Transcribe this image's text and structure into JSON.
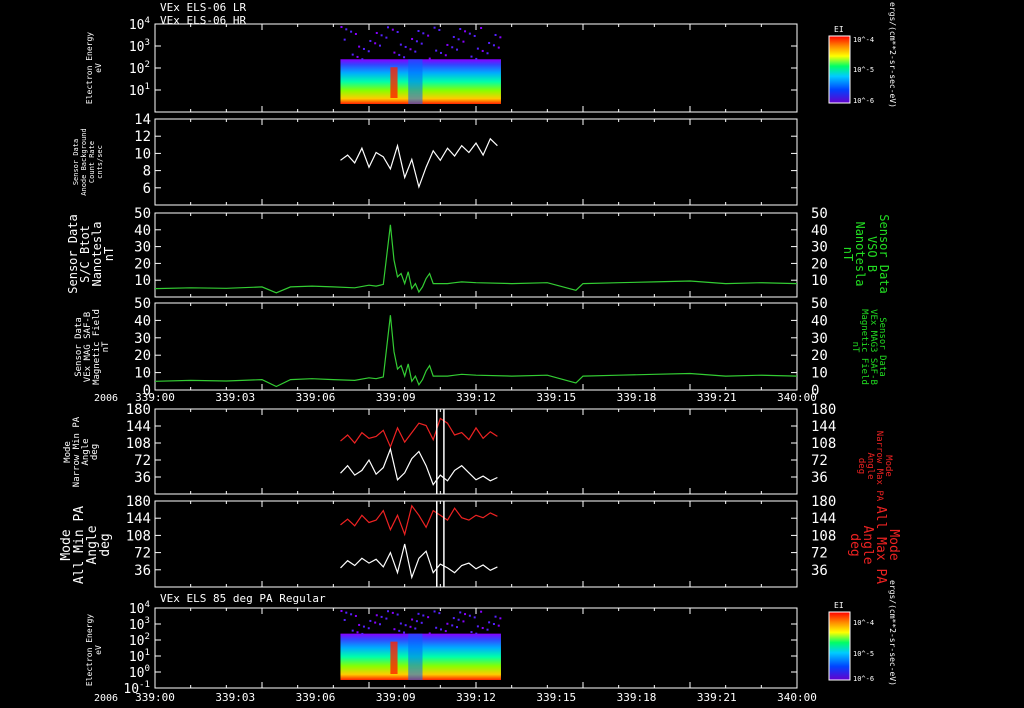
{
  "header": {
    "line1": "VEx ELS-06 LR",
    "line2": "VEx ELS-06 HR"
  },
  "year_label": "2006",
  "x_axis": {
    "ticks": [
      "339:00",
      "339:03",
      "339:06",
      "339:09",
      "339:12",
      "339:15",
      "339:18",
      "339:21",
      "340:00"
    ],
    "range_minutes": [
      0,
      180
    ]
  },
  "colors": {
    "background": "#000000",
    "axis": "#ffffff",
    "magnetometer": "#33cc33",
    "max_pa": "#ee2222",
    "min_pa": "#ffffff",
    "label_green": "#22dd22",
    "label_red": "#ee2222"
  },
  "chart_data": [
    {
      "type": "heatmap",
      "id": "spectrogram_top",
      "ylabel": [
        "Electron Energy",
        "eV"
      ],
      "yscale": "log",
      "ylim": [
        1,
        10000
      ],
      "yticks": [
        "10^4",
        "10^3",
        "10^2",
        "10^1"
      ],
      "data_xrange_minutes": [
        52,
        97
      ],
      "colorbar": {
        "title": "EI",
        "ticks": [
          "10^-4",
          "10^-5",
          "10^-6"
        ]
      },
      "units_right": "ergs/(cm**2-sr-sec-eV)"
    },
    {
      "type": "line",
      "id": "count_rate",
      "ylabel": [
        "Sensor Data",
        "Anode Background",
        "Count Rate",
        "cnts/sec"
      ],
      "ylim": [
        4,
        14
      ],
      "yticks": [
        6,
        8,
        10,
        12,
        14
      ],
      "series": [
        {
          "color": "white",
          "x": [
            52,
            54,
            56,
            58,
            60,
            62,
            64,
            66,
            68,
            70,
            72,
            74,
            76,
            78,
            80,
            82,
            84,
            86,
            88,
            90,
            92,
            94,
            96
          ],
          "y": [
            9.2,
            9.8,
            8.9,
            10.6,
            8.4,
            10.1,
            9.6,
            8.2,
            10.9,
            7.2,
            9.3,
            6.1,
            8.4,
            10.3,
            9.2,
            10.6,
            9.7,
            10.9,
            10.1,
            11.2,
            9.8,
            11.7,
            10.9
          ]
        }
      ]
    },
    {
      "type": "line",
      "id": "bmag_sc",
      "ylabel": [
        "Sensor Data",
        "S/C Btot",
        "Nanotesla",
        "nT"
      ],
      "ylabel_right": [
        "Sensor Data",
        "VSO B",
        "Nanotesla",
        "nT"
      ],
      "ylim": [
        0,
        50
      ],
      "yticks": [
        10,
        20,
        30,
        40,
        50
      ],
      "series": [
        {
          "color": "green",
          "x": [
            0,
            10,
            20,
            30,
            34,
            38,
            44,
            50,
            56,
            60,
            62,
            64,
            66,
            67,
            68,
            69,
            70,
            71,
            72,
            73,
            74,
            75,
            76,
            77,
            78,
            80,
            82,
            84,
            86,
            90,
            100,
            110,
            118,
            120,
            130,
            140,
            150,
            160,
            170,
            180
          ],
          "y": [
            5,
            5.5,
            5.2,
            6,
            2.5,
            6,
            6.5,
            6,
            5.5,
            7,
            6.5,
            7.5,
            43,
            22,
            12,
            14,
            8,
            15,
            5,
            8,
            3,
            6,
            11,
            14,
            8,
            8,
            8,
            8.5,
            9,
            8.5,
            8,
            8.5,
            4,
            8,
            8.5,
            9,
            9.5,
            8,
            8.5,
            8
          ]
        }
      ]
    },
    {
      "type": "line",
      "id": "bmag_saf",
      "ylabel": [
        "Sensor Data",
        "VEx MAG SAF-B",
        "Magnetic Field",
        "nT"
      ],
      "ylabel_right": [
        "Sensor Data",
        "VEx MAG3 SAF-B",
        "Magnetic Field",
        "nT"
      ],
      "ylim": [
        0,
        50
      ],
      "yticks": [
        0,
        10,
        20,
        30,
        40,
        50
      ],
      "series": [
        {
          "color": "green",
          "x": [
            0,
            10,
            20,
            30,
            34,
            38,
            44,
            50,
            56,
            60,
            62,
            64,
            66,
            67,
            68,
            69,
            70,
            71,
            72,
            73,
            74,
            75,
            76,
            77,
            78,
            80,
            82,
            84,
            86,
            90,
            100,
            110,
            118,
            120,
            130,
            140,
            150,
            160,
            170,
            180
          ],
          "y": [
            5,
            5.5,
            5.2,
            6,
            2,
            6,
            6.5,
            6,
            5.5,
            7,
            6.5,
            7.5,
            43,
            22,
            12,
            14,
            8,
            15,
            5,
            8,
            3,
            6,
            11,
            14,
            8,
            8,
            8,
            8.5,
            9,
            8.5,
            8,
            8.5,
            4,
            8,
            8.5,
            9,
            9.5,
            8,
            8.5,
            8
          ]
        }
      ]
    },
    {
      "type": "line",
      "id": "pa_narrow",
      "ylabel": [
        "Mode",
        "Narrow Min PA",
        "Angle",
        "deg"
      ],
      "ylabel_right": [
        "Mode",
        "Narrow Max PA",
        "Angle",
        "deg"
      ],
      "ylim": [
        0,
        180
      ],
      "yticks": [
        36,
        72,
        108,
        144,
        180
      ],
      "series": [
        {
          "color": "red",
          "x": [
            52,
            54,
            56,
            58,
            60,
            62,
            64,
            66,
            68,
            70,
            72,
            74,
            76,
            78,
            80,
            82,
            84,
            86,
            88,
            90,
            92,
            94,
            96
          ],
          "y": [
            112,
            125,
            108,
            130,
            118,
            122,
            135,
            100,
            140,
            110,
            130,
            150,
            145,
            115,
            160,
            150,
            125,
            130,
            115,
            140,
            118,
            132,
            122
          ]
        },
        {
          "color": "white",
          "x": [
            52,
            54,
            56,
            58,
            60,
            62,
            64,
            66,
            68,
            70,
            72,
            74,
            76,
            78,
            80,
            82,
            84,
            86,
            88,
            90,
            92,
            94,
            96
          ],
          "y": [
            44,
            60,
            40,
            50,
            72,
            42,
            56,
            95,
            30,
            45,
            75,
            90,
            60,
            20,
            40,
            28,
            50,
            60,
            45,
            30,
            38,
            28,
            35
          ]
        }
      ],
      "markers_x": [
        79,
        81
      ]
    },
    {
      "type": "line",
      "id": "pa_all",
      "ylabel": [
        "Mode",
        "All Min PA",
        "Angle",
        "deg"
      ],
      "ylabel_right": [
        "Mode",
        "All Max PA",
        "Angle",
        "deg"
      ],
      "ylim": [
        0,
        180
      ],
      "yticks": [
        36,
        72,
        108,
        144,
        180
      ],
      "series": [
        {
          "color": "red",
          "x": [
            52,
            54,
            56,
            58,
            60,
            62,
            64,
            66,
            68,
            70,
            72,
            74,
            76,
            78,
            80,
            82,
            84,
            86,
            88,
            90,
            92,
            94,
            96
          ],
          "y": [
            130,
            142,
            128,
            150,
            135,
            140,
            160,
            120,
            150,
            110,
            170,
            150,
            125,
            160,
            150,
            140,
            165,
            145,
            140,
            150,
            145,
            155,
            148
          ]
        },
        {
          "color": "white",
          "x": [
            52,
            54,
            56,
            58,
            60,
            62,
            64,
            66,
            68,
            70,
            72,
            74,
            76,
            78,
            80,
            82,
            84,
            86,
            88,
            90,
            92,
            94,
            96
          ],
          "y": [
            40,
            55,
            45,
            60,
            50,
            58,
            42,
            72,
            30,
            90,
            20,
            60,
            75,
            30,
            48,
            40,
            30,
            45,
            50,
            38,
            46,
            35,
            42
          ]
        }
      ],
      "markers_x": [
        79,
        81
      ]
    },
    {
      "type": "heatmap",
      "id": "spectrogram_bottom",
      "title": "VEx ELS 85 deg PA Regular",
      "ylabel": [
        "Electron Energy",
        "eV"
      ],
      "yscale": "log",
      "ylim": [
        0.1,
        10000
      ],
      "yticks": [
        "10^4",
        "10^3",
        "10^2",
        "10^1",
        "10^0",
        "10^-1"
      ],
      "data_xrange_minutes": [
        52,
        97
      ],
      "colorbar": {
        "title": "EI",
        "ticks": [
          "10^-4",
          "10^-5",
          "10^-6"
        ]
      },
      "units_right": "ergs/(cm**2-sr-sec-eV)"
    }
  ]
}
